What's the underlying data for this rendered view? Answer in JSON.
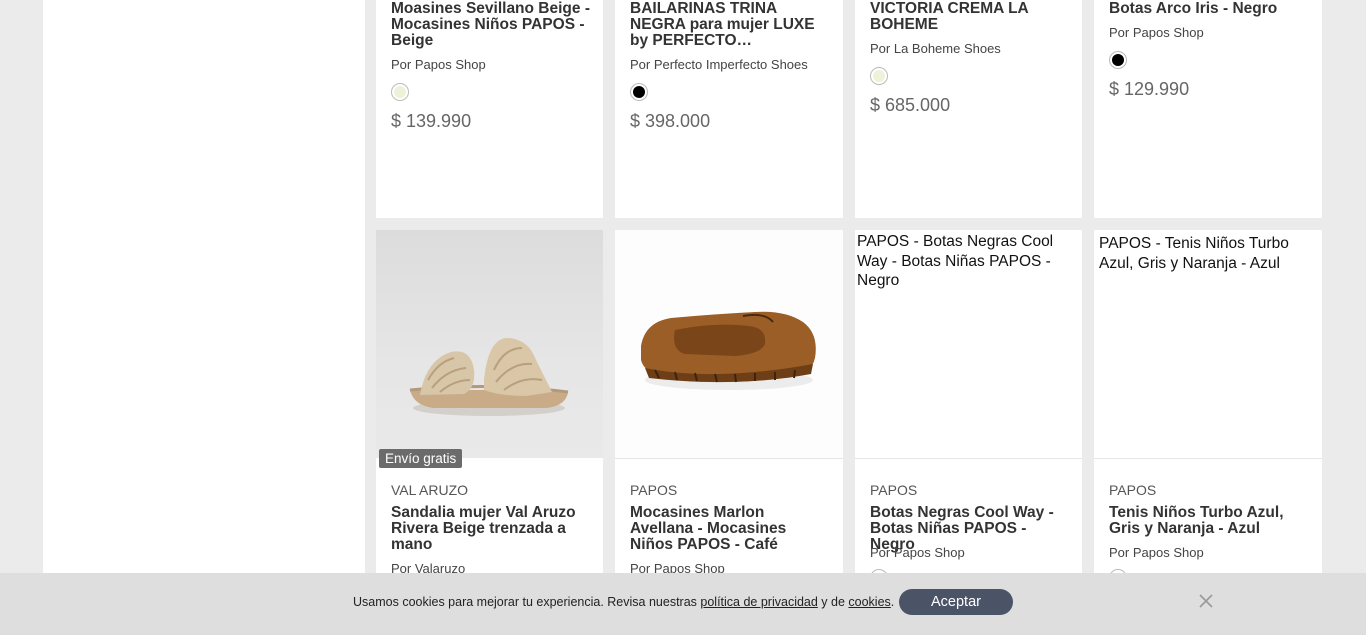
{
  "row1": [
    {
      "title": "Moasines Sevillano Beige - Mocasines Niños PAPOS - Beige",
      "seller": "Por Papos Shop",
      "swatch": "#eef2d8",
      "price": "$ 139.990"
    },
    {
      "title": "BAILARINAS TRINA NEGRA para mujer LUXE by PERFECTO…",
      "seller": "Por Perfecto Imperfecto Shoes",
      "swatch": "#000000",
      "price": "$ 398.000"
    },
    {
      "title": "VICTORIA CREMA LA BOHEME",
      "seller": "Por La Boheme Shoes",
      "swatch": "#eef2d8",
      "price": "$ 685.000"
    },
    {
      "title": "Botas Arco Iris - Negro",
      "seller": "Por Papos Shop",
      "swatch": "#000000",
      "price": "$ 129.990"
    }
  ],
  "row2": [
    {
      "alt": "",
      "badge": "Envío gratis",
      "brand": "VAL ARUZO",
      "title": "Sandalia mujer Val Aruzo Rivera Beige trenzada a mano",
      "seller": "Por Valaruzo"
    },
    {
      "alt": "",
      "badge": "",
      "brand": "PAPOS",
      "title": "Mocasines Marlon Avellana - Mocasines Niños PAPOS - Café",
      "seller": "Por Papos Shop"
    },
    {
      "alt": "PAPOS - Botas Negras Cool Way - Botas Niñas PAPOS - Negro",
      "badge": "",
      "brand": "PAPOS",
      "title": "Botas Negras Cool Way - Botas Niñas PAPOS - Negro",
      "seller": "Por Papos Shop"
    },
    {
      "alt": "PAPOS - Tenis Niños Turbo Azul, Gris y Naranja - Azul",
      "badge": "",
      "brand": "PAPOS",
      "title": "Tenis Niños Turbo Azul, Gris y Naranja - Azul",
      "seller": "Por Papos Shop"
    }
  ],
  "cookie": {
    "text_before": "Usamos cookies para mejorar tu experiencia. Revisa nuestras ",
    "privacy_link": "política de privacidad",
    "text_middle": " y de ",
    "cookies_link": "cookies",
    "text_after": ".",
    "accept_label": "Aceptar"
  },
  "icons": {
    "close": "close-icon"
  }
}
